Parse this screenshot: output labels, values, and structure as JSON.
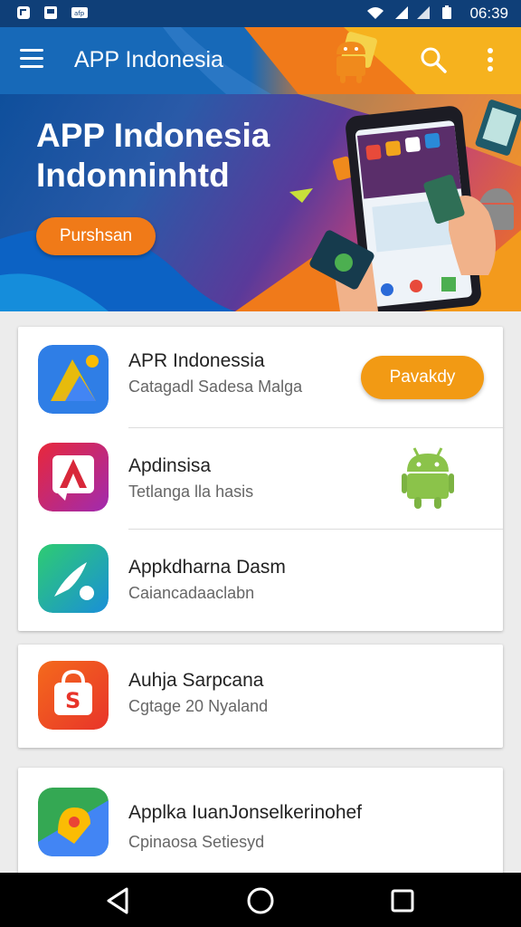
{
  "status_bar": {
    "time": "06:39",
    "left_icons": [
      "notification-icon",
      "gallery-icon",
      "app-notification-icon"
    ],
    "right_icons": [
      "wifi-icon",
      "signal-icon",
      "signal-icon",
      "battery-icon"
    ]
  },
  "app_bar": {
    "title": "APP Indonesia",
    "icons": [
      "menu-icon",
      "search-icon",
      "more-vert-icon"
    ]
  },
  "hero": {
    "line1": "APP Indonesia",
    "line2": "Indonninhtd",
    "button_label": "Purshsan"
  },
  "apps": [
    {
      "name": "APR Indonessia",
      "subtitle": "Catagadl Sadesa Malga",
      "action_label": "Pavakdy",
      "icon": "maps-icon"
    },
    {
      "name": "Apdinsisa",
      "subtitle": "Tetlanga lla hasis",
      "icon": "a-logo-icon",
      "badge_icon": "android-icon"
    },
    {
      "name": "Appkdharna Dasm",
      "subtitle": "Caiancadaaclabn",
      "icon": "leaf-icon"
    },
    {
      "name": "Auhja Sarpcana",
      "subtitle": "Cgtage 20 Nyaland",
      "icon": "shopping-bag-icon"
    },
    {
      "name": "Applka IuanJonselkerinohef",
      "subtitle": "Cpinaosa Setiesyd",
      "icon": "maps-icon"
    }
  ],
  "nav_bar": {
    "icons": [
      "back-icon",
      "home-icon",
      "recents-icon"
    ]
  },
  "colors": {
    "accent": "#f29a14",
    "brand_blue": "#1769b8"
  }
}
